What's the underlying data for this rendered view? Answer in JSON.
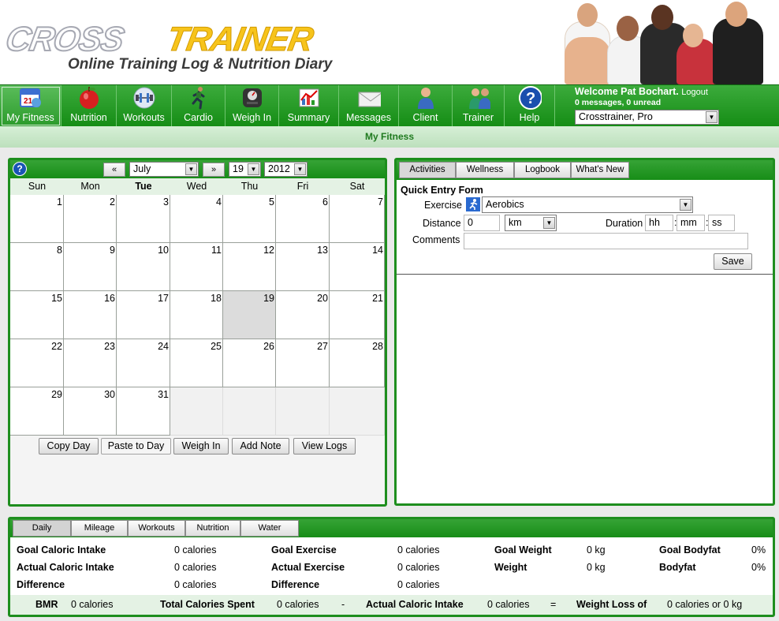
{
  "header": {
    "logo_part1": "CROSS",
    "logo_part2": "TRAINER",
    "tagline": "Online Training Log & Nutrition Diary"
  },
  "nav": {
    "items": [
      {
        "label": "My Fitness",
        "icon": "calendar-icon"
      },
      {
        "label": "Nutrition",
        "icon": "apple-icon"
      },
      {
        "label": "Workouts",
        "icon": "dumbbell-icon"
      },
      {
        "label": "Cardio",
        "icon": "runner-icon"
      },
      {
        "label": "Weigh In",
        "icon": "scale-icon"
      },
      {
        "label": "Summary",
        "icon": "chart-icon"
      },
      {
        "label": "Messages",
        "icon": "envelope-icon"
      },
      {
        "label": "Client",
        "icon": "person-icon"
      },
      {
        "label": "Trainer",
        "icon": "people-icon"
      },
      {
        "label": "Help",
        "icon": "help-icon"
      }
    ],
    "welcome": "Welcome Pat Bochart.",
    "logout": "Logout",
    "messages": "0 messages, 0 unread",
    "user_select": "Crosstrainer, Pro"
  },
  "subbar_title": "My Fitness",
  "calendar": {
    "prev": "«",
    "next": "»",
    "month": "July",
    "day": "19",
    "year": "2012",
    "weekdays": [
      "Sun",
      "Mon",
      "Tue",
      "Wed",
      "Thu",
      "Fri",
      "Sat"
    ],
    "today_weekday": "Tue",
    "weeks": [
      [
        "1",
        "2",
        "3",
        "4",
        "5",
        "6",
        "7"
      ],
      [
        "8",
        "9",
        "10",
        "11",
        "12",
        "13",
        "14"
      ],
      [
        "15",
        "16",
        "17",
        "18",
        "19",
        "20",
        "21"
      ],
      [
        "22",
        "23",
        "24",
        "25",
        "26",
        "27",
        "28"
      ],
      [
        "29",
        "30",
        "31",
        "",
        "",
        "",
        ""
      ]
    ],
    "selected_day": "19",
    "buttons": [
      "Copy Day",
      "Paste to Day",
      "Weigh In",
      "Add Note",
      "View Logs"
    ]
  },
  "entry": {
    "tabs": [
      "Activities",
      "Wellness",
      "Logbook",
      "What's New"
    ],
    "form_title": "Quick Entry Form",
    "exercise_label": "Exercise",
    "exercise_value": "Aerobics",
    "distance_label": "Distance",
    "distance_value": "0",
    "unit_value": "km",
    "duration_label": "Duration",
    "hh": "hh",
    "mm": "mm",
    "ss": "ss",
    "sep": ":",
    "comments_label": "Comments",
    "save": "Save"
  },
  "summary": {
    "tabs": [
      "Daily",
      "Mileage",
      "Workouts",
      "Nutrition",
      "Water"
    ],
    "goal_caloric_intake": "Goal Caloric Intake",
    "actual_caloric_intake": "Actual Caloric Intake",
    "difference": "Difference",
    "goal_exercise": "Goal Exercise",
    "actual_exercise": "Actual Exercise",
    "goal_weight": "Goal Weight",
    "weight": "Weight",
    "goal_bodyfat": "Goal Bodyfat",
    "bodyfat": "Bodyfat",
    "zero_cal": "0 calories",
    "zero_kg": "0 kg",
    "zero_pct": "0%",
    "bmr_label": "BMR",
    "total_spent_label": "Total Calories Spent",
    "minus": "-",
    "actual_intake_label": "Actual Caloric Intake",
    "equals": "=",
    "weight_loss_label": "Weight Loss of",
    "weight_loss_value": "0 calories or 0 kg"
  }
}
